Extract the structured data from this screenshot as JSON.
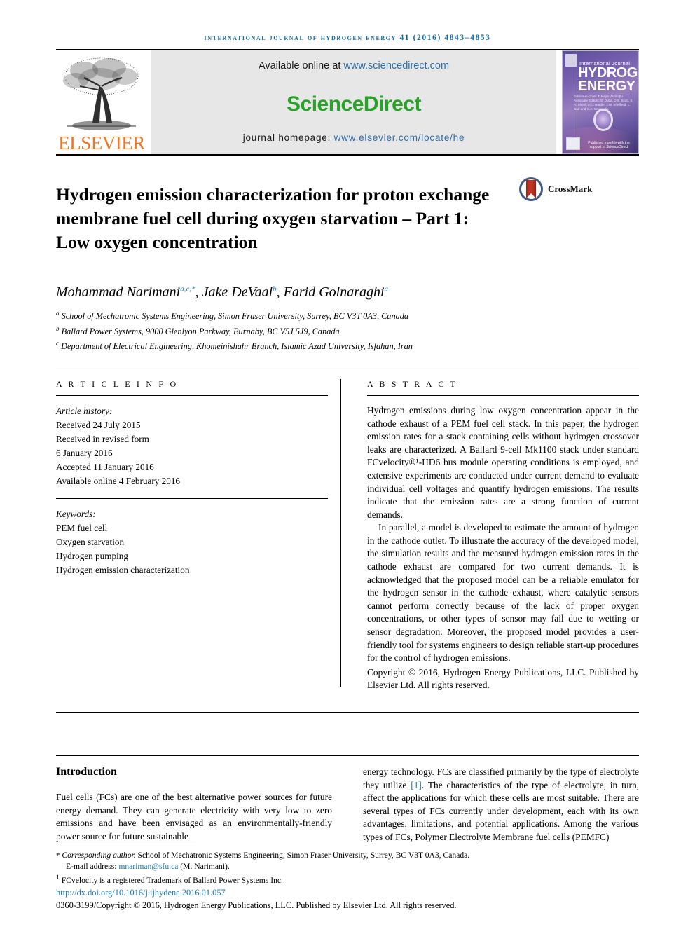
{
  "running_head": "International Journal of Hydrogen Energy 41 (2016) 4843–4853",
  "masthead": {
    "publisher": "ELSEVIER",
    "available_prefix": "Available online at ",
    "available_url": "www.sciencedirect.com",
    "sciencedirect_logo": "ScienceDirect",
    "homepage_prefix": "journal homepage: ",
    "homepage_url": "www.elsevier.com/locate/he",
    "cover": {
      "line1": "International Journal of",
      "line2": "HYDROGEN",
      "line3": "ENERGY",
      "editors": "Editors-in-Chief: T. Nejat Veziroğlu\nAssociate Editors: S. Dutta, D.S. Scott, S. A. Sherif, A.C. Hurdle, J.W. Sheffield, L. Carl and C.A. Smeraglia",
      "footer": "Published monthly with the support of\nScienceDirect"
    }
  },
  "article": {
    "title": "Hydrogen emission characterization for proton exchange membrane fuel cell during oxygen starvation – Part 1: Low oxygen concentration",
    "crossmark_label": "CrossMark",
    "authors": [
      {
        "name": "Mohammad Narimani",
        "marks": "a,c,*"
      },
      {
        "name": "Jake DeVaal",
        "marks": "b"
      },
      {
        "name": "Farid Golnaraghi",
        "marks": "a"
      }
    ],
    "affiliations": [
      {
        "mark": "a",
        "text": "School of Mechatronic Systems Engineering, Simon Fraser University, Surrey, BC V3T 0A3, Canada"
      },
      {
        "mark": "b",
        "text": "Ballard Power Systems, 9000 Glenlyon Parkway, Burnaby, BC V5J 5J9, Canada"
      },
      {
        "mark": "c",
        "text": "Department of Electrical Engineering, Khomeinishahr Branch, Islamic Azad University, Isfahan, Iran"
      }
    ]
  },
  "article_info": {
    "heading": "A R T I C L E   I N F O",
    "history_label": "Article history:",
    "history": [
      "Received 24 July 2015",
      "Received in revised form",
      "6 January 2016",
      "Accepted 11 January 2016",
      "Available online 4 February 2016"
    ],
    "keywords_label": "Keywords:",
    "keywords": [
      "PEM fuel cell",
      "Oxygen starvation",
      "Hydrogen pumping",
      "Hydrogen emission characterization"
    ]
  },
  "abstract": {
    "heading": "A B S T R A C T",
    "paragraphs": [
      "Hydrogen emissions during low oxygen concentration appear in the cathode exhaust of a PEM fuel cell stack. In this paper, the hydrogen emission rates for a stack containing cells without hydrogen crossover leaks are characterized. A Ballard 9-cell Mk1100 stack under standard FCvelocity®¹-HD6 bus module operating conditions is employed, and extensive experiments are conducted under current demand to evaluate individual cell voltages and quantify hydrogen emissions. The results indicate that the emission rates are a strong function of current demands.",
      "In parallel, a model is developed to estimate the amount of hydrogen in the cathode outlet. To illustrate the accuracy of the developed model, the simulation results and the measured hydrogen emission rates in the cathode exhaust are compared for two current demands. It is acknowledged that the proposed model can be a reliable emulator for the hydrogen sensor in the cathode exhaust, where catalytic sensors cannot perform correctly because of the lack of proper oxygen concentrations, or other types of sensor may fail due to wetting or sensor degradation. Moreover, the proposed model provides a user-friendly tool for systems engineers to design reliable start-up procedures for the control of hydrogen emissions."
    ],
    "copyright": "Copyright © 2016, Hydrogen Energy Publications, LLC. Published by Elsevier Ltd. All rights reserved."
  },
  "body": {
    "intro_heading": "Introduction",
    "left_paragraph": "Fuel cells (FCs) are one of the best alternative power sources for future energy demand. They can generate electricity with very low to zero emissions and have been envisaged as an environmentally-friendly power source for future sustainable",
    "right_paragraph_pre": "energy technology. FCs are classified primarily by the type of electrolyte they utilize ",
    "right_reference": "[1]",
    "right_paragraph_post": ". The characteristics of the type of electrolyte, in turn, affect the applications for which these cells are most suitable. There are several types of FCs currently under development, each with its own advantages, limitations, and potential applications. Among the various types of FCs, Polymer Electrolyte Membrane fuel cells (PEMFC)"
  },
  "footnotes": {
    "corresponding_label": "Corresponding author.",
    "corresponding_text": " School of Mechatronic Systems Engineering, Simon Fraser University, Surrey, BC V3T 0A3, Canada.",
    "email_label": "E-mail address: ",
    "email": "mnariman@sfu.ca",
    "email_suffix": " (M. Narimani).",
    "trademark_mark": "1",
    "trademark_text": " FCvelocity is a registered Trademark of Ballard Power Systems Inc.",
    "doi": "http://dx.doi.org/10.1016/j.ijhydene.2016.01.057",
    "issn_line": "0360-3199/Copyright © 2016, Hydrogen Energy Publications, LLC. Published by Elsevier Ltd. All rights reserved."
  },
  "colors": {
    "link": "#1f7ab4",
    "running_head": "#0d6ba5",
    "elsevier_orange": "#ee7624",
    "sciencedirect_green": "#2aa22a"
  }
}
